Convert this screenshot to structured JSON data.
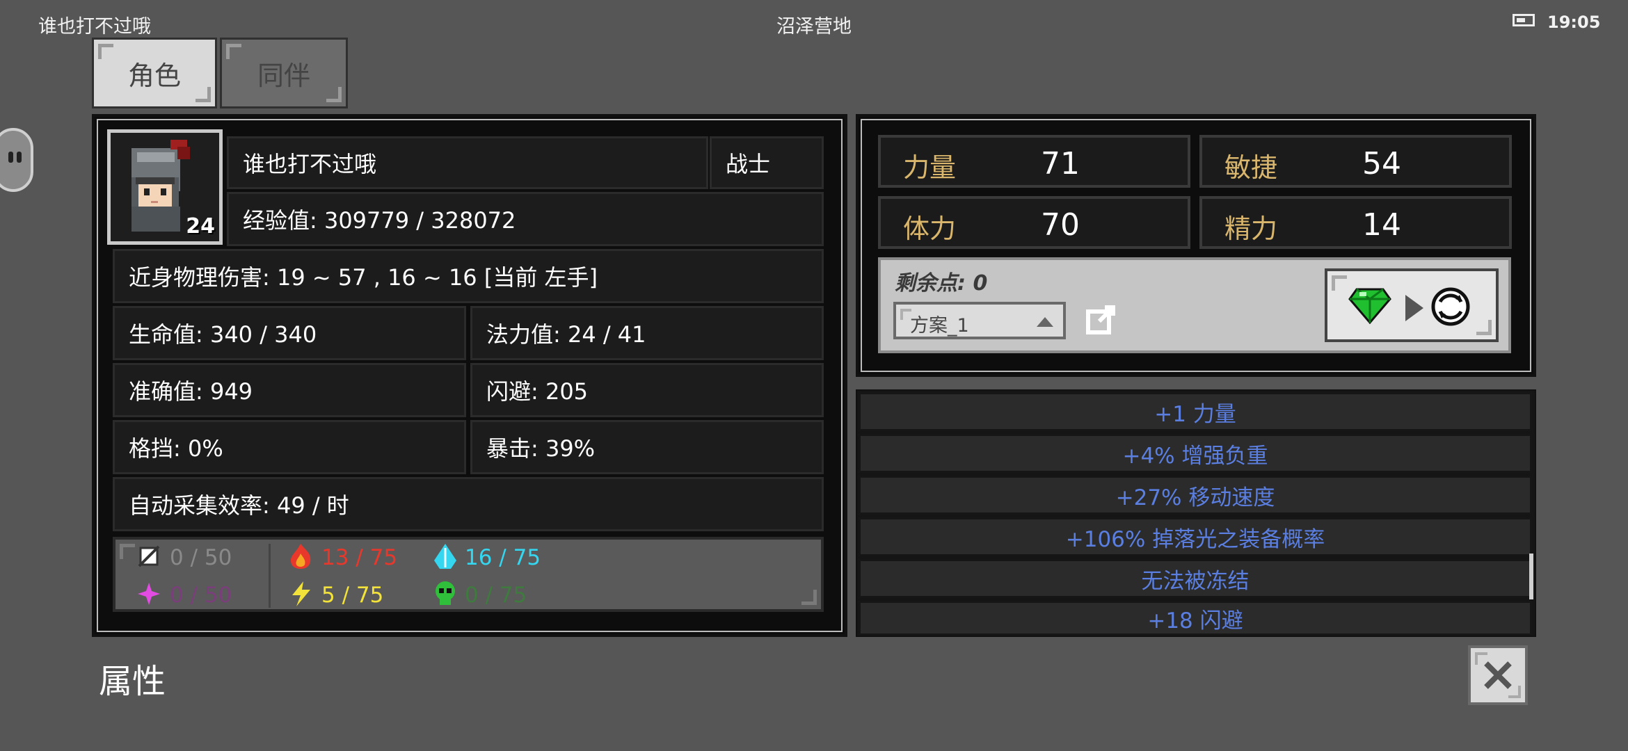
{
  "status_bar": {
    "left_text": "谁也打不过哦",
    "center_text": "沼泽营地",
    "time": "19:05"
  },
  "tabs": [
    {
      "label": "角色"
    },
    {
      "label": "同伴"
    }
  ],
  "character": {
    "name": "谁也打不过哦",
    "class": "战士",
    "level": "24",
    "exp": "经验值: 309779 / 328072",
    "melee_damage": "近身物理伤害: 19 ~ 57 , 16 ~ 16 [当前 左手]",
    "stats": [
      {
        "text": "生命值: 340 / 340"
      },
      {
        "text": "法力值: 24 / 41"
      },
      {
        "text": "准确值: 949"
      },
      {
        "text": "闪避: 205"
      },
      {
        "text": "格挡: 0%"
      },
      {
        "text": "暴击: 39%"
      }
    ],
    "gather_rate": "自动采集效率: 49 / 时",
    "resistances": [
      {
        "icon": "physical-resist-icon",
        "text": "0 / 50",
        "color": "#8a8a8a"
      },
      {
        "icon": "fire-resist-icon",
        "text": "13 / 75",
        "color": "#e8382c"
      },
      {
        "icon": "ice-resist-icon",
        "text": "16 / 75",
        "color": "#35d6f0"
      },
      {
        "icon": "arcane-resist-icon",
        "text": "0 / 50",
        "color": "#7a3f7a"
      },
      {
        "icon": "lightning-resist-icon",
        "text": "5 / 75",
        "color": "#f2e23a"
      },
      {
        "icon": "poison-resist-icon",
        "text": "0 / 75",
        "color": "#3f7a3f"
      }
    ]
  },
  "attributes": [
    {
      "name": "力量",
      "value": "71"
    },
    {
      "name": "敏捷",
      "value": "54"
    },
    {
      "name": "体力",
      "value": "70"
    },
    {
      "name": "精力",
      "value": "14"
    }
  ],
  "points": {
    "remaining": "剩余点: 0",
    "preset": "方案_1"
  },
  "bonuses": [
    "+1 力量",
    "+4% 增强负重",
    "+27% 移动速度",
    "+106% 掉落光之装备概率",
    "无法被冻结",
    "+18 闪避"
  ],
  "footer": {
    "title": "属性"
  },
  "colors": {
    "gold": "#d9b66c",
    "bonus_blue": "#5b7fe0",
    "background": "#565656"
  }
}
